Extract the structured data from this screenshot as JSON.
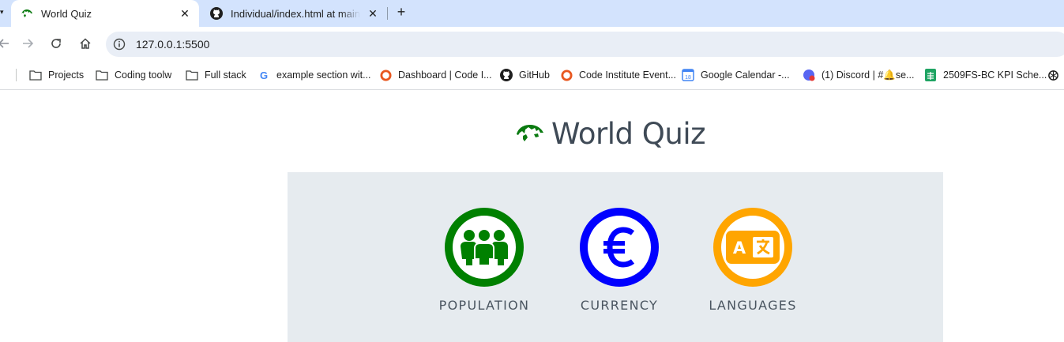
{
  "browser": {
    "tabs": [
      {
        "title": "World Quiz",
        "active": true,
        "icon": "world-globe-icon"
      },
      {
        "title": "Individual/index.html at main · g",
        "active": false,
        "icon": "github-icon"
      }
    ],
    "address": {
      "url": "127.0.0.1:5500"
    },
    "bookmarks": [
      {
        "label": "Projects",
        "icon": "folder-icon"
      },
      {
        "label": "Coding toolw",
        "icon": "folder-icon"
      },
      {
        "label": "Full stack",
        "icon": "folder-icon"
      },
      {
        "label": "example section wit...",
        "icon": "google-icon"
      },
      {
        "label": "Dashboard | Code I...",
        "icon": "code-institute-icon"
      },
      {
        "label": "GitHub",
        "icon": "github-icon"
      },
      {
        "label": "Code Institute Event...",
        "icon": "code-institute-icon"
      },
      {
        "label": "Google Calendar -...",
        "icon": "calendar-icon"
      },
      {
        "label": "(1) Discord | #🔔se...",
        "icon": "discord-icon"
      },
      {
        "label": "2509FS-BC KPI Sche...",
        "icon": "sheets-icon"
      }
    ]
  },
  "site": {
    "title": "World Quiz",
    "logo_color": "#0a7a10",
    "categories": [
      {
        "label": "POPULATION",
        "color": "#008000",
        "icon": "people-icon"
      },
      {
        "label": "CURRENCY",
        "color": "#0000ff",
        "icon": "euro-icon"
      },
      {
        "label": "LANGUAGES",
        "color": "#ffa500",
        "icon": "translate-icon"
      }
    ]
  },
  "colors": {
    "tabstrip": "#d3e3fd",
    "omnibox": "#e9eef6",
    "panel": "#e6ebef",
    "title_text": "#3f4a56"
  }
}
